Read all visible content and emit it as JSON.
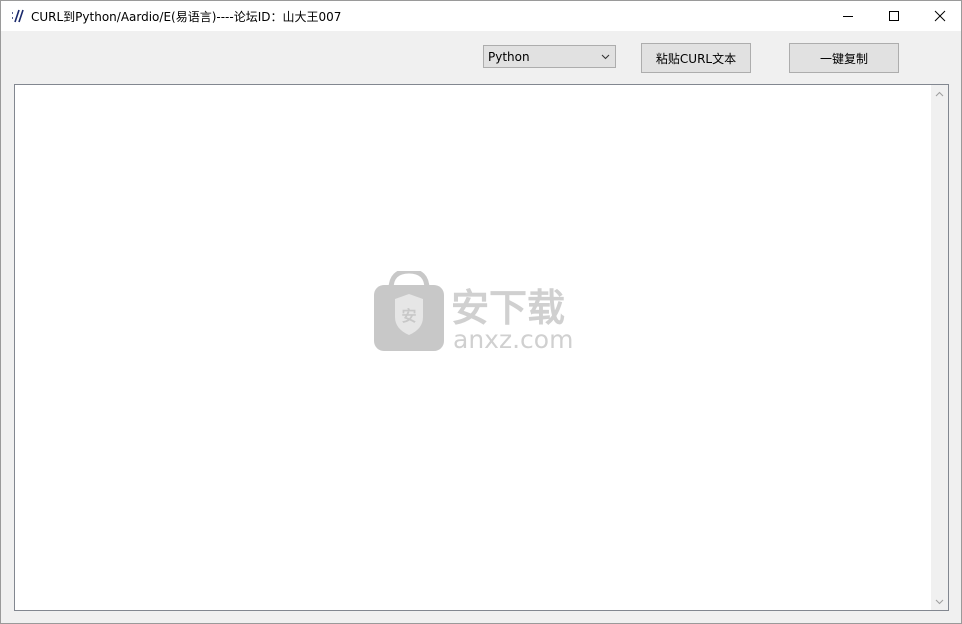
{
  "window": {
    "title": "CURL到Python/Aardio/E(易语言)----论坛ID：山大王007"
  },
  "toolbar": {
    "language_selected": "Python",
    "paste_button_label": "粘贴CURL文本",
    "copy_button_label": "一键复制"
  },
  "output": {
    "text": ""
  },
  "watermark": {
    "shield_glyph": "安",
    "brand_name": "安下载",
    "brand_domain": "anxz.com"
  }
}
